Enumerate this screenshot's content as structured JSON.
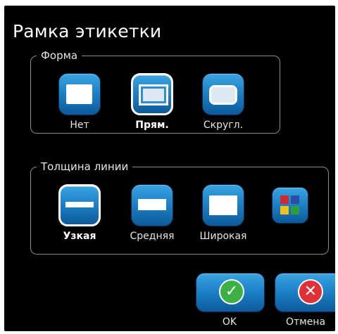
{
  "dialog": {
    "title": "Рамка этикетки"
  },
  "shape": {
    "legend": "Форма",
    "options": [
      {
        "label": "Нет",
        "icon": "no-frame-icon",
        "selected": false
      },
      {
        "label": "Прям.",
        "icon": "rectangle-frame-icon",
        "selected": true
      },
      {
        "label": "Скругл.",
        "icon": "rounded-frame-icon",
        "selected": false
      }
    ]
  },
  "thickness": {
    "legend": "Толщина линии",
    "options": [
      {
        "label": "Узкая",
        "icon": "thin-line-icon",
        "selected": true
      },
      {
        "label": "Средняя",
        "icon": "medium-line-icon",
        "selected": false
      },
      {
        "label": "Широкая",
        "icon": "wide-line-icon",
        "selected": false
      }
    ],
    "extra_icon": "color-grid-icon"
  },
  "buttons": {
    "ok_label": "OK",
    "cancel_label": "Отмена"
  },
  "colors": {
    "accent_blue": "#1e82c8",
    "ok_green": "#3cb043",
    "cancel_red": "#e0303a",
    "grid": [
      "#cf2a2f",
      "#2b4ea8",
      "#f0c020",
      "#2e9e3a"
    ]
  }
}
